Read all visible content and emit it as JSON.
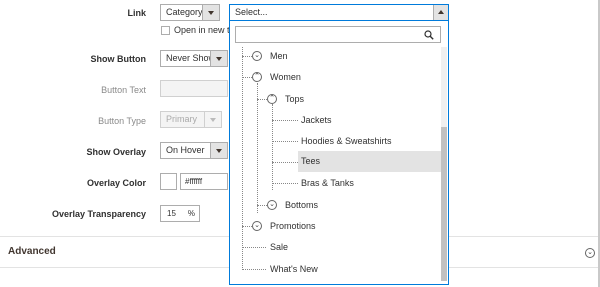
{
  "fields": {
    "link": {
      "label": "Link",
      "type_value": "Category",
      "new_tab_label": "Open in new tab"
    },
    "show_button": {
      "label": "Show Button",
      "value": "Never Show"
    },
    "button_text": {
      "label": "Button Text",
      "value": ""
    },
    "button_type": {
      "label": "Button Type",
      "value": "Primary"
    },
    "show_overlay": {
      "label": "Show Overlay",
      "value": "On Hover"
    },
    "overlay_color": {
      "label": "Overlay Color",
      "value": "#ffffff",
      "swatch": "#ffffff"
    },
    "overlay_transparency": {
      "label": "Overlay Transparency",
      "value": "15",
      "unit": "%"
    }
  },
  "advanced": {
    "title": "Advanced",
    "toggle_icon": "chevron-down-icon"
  },
  "dropdown": {
    "placeholder": "Select...",
    "search_value": "",
    "search_icon": "search-icon",
    "tree": [
      {
        "label": "Men",
        "toggle": "expand"
      },
      {
        "label": "Women",
        "toggle": "collapse"
      },
      {
        "label": "Tops",
        "toggle": "collapse"
      },
      {
        "label": "Jackets"
      },
      {
        "label": "Hoodies & Sweatshirts"
      },
      {
        "label": "Tees",
        "highlighted": true
      },
      {
        "label": "Bras & Tanks"
      },
      {
        "label": "Bottoms",
        "toggle": "expand"
      },
      {
        "label": "Promotions",
        "toggle": "expand"
      },
      {
        "label": "Sale"
      },
      {
        "label": "What's New"
      }
    ]
  }
}
